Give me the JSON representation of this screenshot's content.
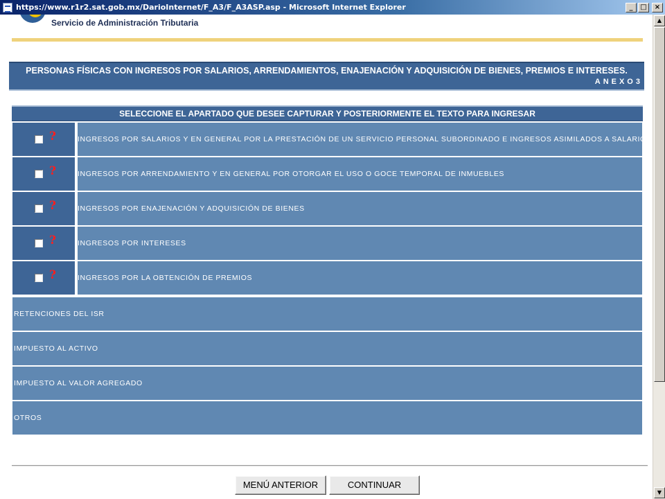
{
  "window": {
    "title": "https://www.r1r2.sat.gob.mx/DarioInternet/F_A3/F_A3ASP.asp - Microsoft Internet Explorer",
    "controls": {
      "minimize": "_",
      "maximize": "□",
      "close": "×"
    }
  },
  "header": {
    "org_name": "Servicio de Administración Tributaria",
    "title": "PERSONAS FÍSICAS CON INGRESOS POR SALARIOS, ARRENDAMIENTOS, ENAJENACIÓN Y ADQUISICIÓN DE BIENES, PREMIOS E INTERESES.",
    "annex": "ANEXO3"
  },
  "form": {
    "instruction": "SELECCIONE EL APARTADO QUE DESEE CAPTURAR Y POSTERIORMENTE EL TEXTO PARA INGRESAR",
    "help_glyph": "?",
    "checkbox_rows": [
      {
        "label": "INGRESOS POR SALARIOS Y EN GENERAL POR LA PRESTACIÓN DE UN SERVICIO PERSONAL SUBORDINADO E INGRESOS ASIMILADOS A SALARIOS",
        "checked": false
      },
      {
        "label": "INGRESOS POR ARRENDAMIENTO Y EN GENERAL POR OTORGAR EL USO O GOCE TEMPORAL DE INMUEBLES",
        "checked": false
      },
      {
        "label": "INGRESOS POR ENAJENACIÓN Y ADQUISICIÓN DE BIENES",
        "checked": false
      },
      {
        "label": "INGRESOS POR INTERESES",
        "checked": false
      },
      {
        "label": "INGRESOS POR LA OBTENCIÓN DE PREMIOS",
        "checked": false
      }
    ],
    "link_rows": [
      {
        "label": "RETENCIONES DEL ISR"
      },
      {
        "label": "IMPUESTO AL ACTIVO"
      },
      {
        "label": "IMPUESTO AL VALOR AGREGADO"
      },
      {
        "label": "OTROS"
      }
    ]
  },
  "buttons": {
    "back": "MENÚ ANTERIOR",
    "continue": "CONTINUAR"
  },
  "scrollbar": {
    "up": "▲",
    "down": "▼"
  },
  "colors": {
    "band_dark": "#3e6596",
    "row_light": "#6088b2",
    "accent_gold": "#efd27c",
    "help_red": "#ff1f1f"
  }
}
